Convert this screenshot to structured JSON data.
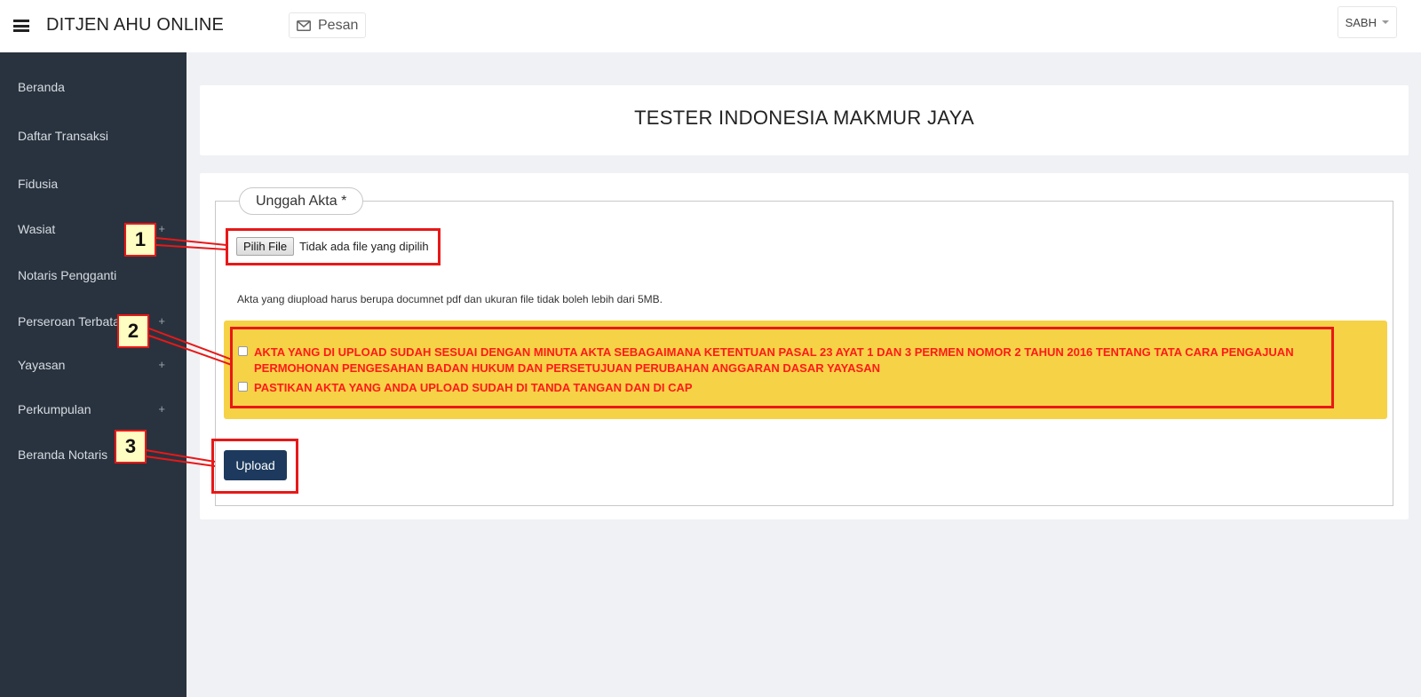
{
  "topbar": {
    "brand": "DITJEN AHU ONLINE",
    "message_label": "Pesan",
    "user_label": "SABH"
  },
  "sidebar": {
    "items": [
      {
        "label": "Beranda",
        "expandable": false
      },
      {
        "label": "Daftar Transaksi",
        "expandable": false
      },
      {
        "label": "Fidusia",
        "expandable": false
      },
      {
        "label": "Wasiat",
        "expandable": true
      },
      {
        "label": "Notaris Pengganti",
        "expandable": false
      },
      {
        "label": "Perseroan Terbatas",
        "expandable": true
      },
      {
        "label": "Yayasan",
        "expandable": true
      },
      {
        "label": "Perkumpulan",
        "expandable": true
      },
      {
        "label": "Beranda Notaris",
        "expandable": false
      }
    ],
    "plus_symbol": "+"
  },
  "header": {
    "company_name": "TESTER INDONESIA MAKMUR JAYA"
  },
  "upload_form": {
    "legend": "Unggah Akta *",
    "file_button_label": "Pilih File",
    "file_status": "Tidak ada file yang dipilih",
    "note": "Akta yang diupload harus berupa documnet pdf dan ukuran file tidak boleh lebih dari 5MB.",
    "checkboxes": [
      {
        "label": "AKTA YANG DI UPLOAD SUDAH SESUAI DENGAN MINUTA AKTA SEBAGAIMANA KETENTUAN PASAL 23 AYAT 1 DAN 3 PERMEN NOMOR 2 TAHUN 2016 TENTANG TATA CARA PENGAJUAN PERMOHONAN PENGESAHAN BADAN HUKUM DAN PERSETUJUAN PERUBAHAN ANGGARAN DASAR YAYASAN",
        "checked": false
      },
      {
        "label": "PASTIKAN AKTA YANG ANDA UPLOAD SUDAH DI TANDA TANGAN DAN DI CAP",
        "checked": false
      }
    ],
    "upload_button_label": "Upload"
  },
  "annotations": {
    "labels": [
      "1",
      "2",
      "3"
    ],
    "color": "#e81818"
  },
  "colors": {
    "sidebar_bg": "#29333f",
    "warning_bg": "#f6d247",
    "warning_text": "#ff1a1a",
    "primary_button": "#1d3a5e"
  }
}
